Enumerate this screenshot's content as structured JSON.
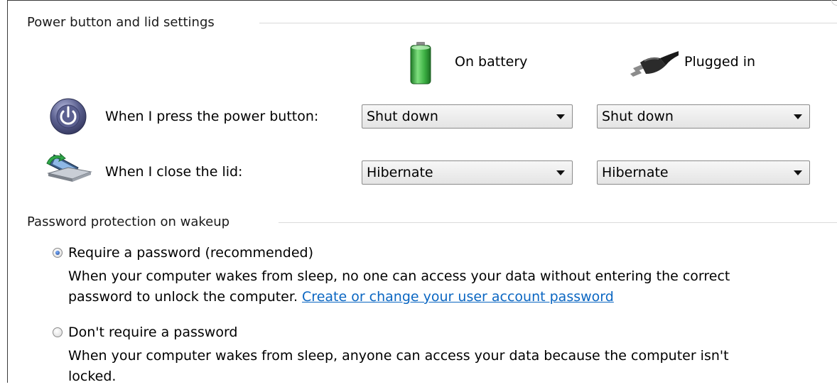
{
  "power_section": {
    "title": "Power button and lid settings",
    "columns": {
      "battery": "On battery",
      "plugged": "Plugged in"
    },
    "rows": [
      {
        "label": "When I press the power button:",
        "battery_value": "Shut down",
        "plugged_value": "Shut down",
        "icon": "power-button-icon"
      },
      {
        "label": "When I close the lid:",
        "battery_value": "Hibernate",
        "plugged_value": "Hibernate",
        "icon": "laptop-lid-icon"
      }
    ]
  },
  "password_section": {
    "title": "Password protection on wakeup",
    "options": [
      {
        "label": "Require a password (recommended)",
        "checked": true,
        "desc_line1": "When your computer wakes from sleep, no one can access your data without entering the correct",
        "desc_line2": "password to unlock the computer. ",
        "link": "Create or change your user account password"
      },
      {
        "label": "Don't require a password",
        "checked": false,
        "desc_line1": "When your computer wakes from sleep, anyone can access your data because the computer isn't",
        "desc_line2": "locked."
      }
    ]
  },
  "colors": {
    "link": "#0a66c2",
    "battery": "#3cb043",
    "power_icon": "#4a4f7a"
  }
}
